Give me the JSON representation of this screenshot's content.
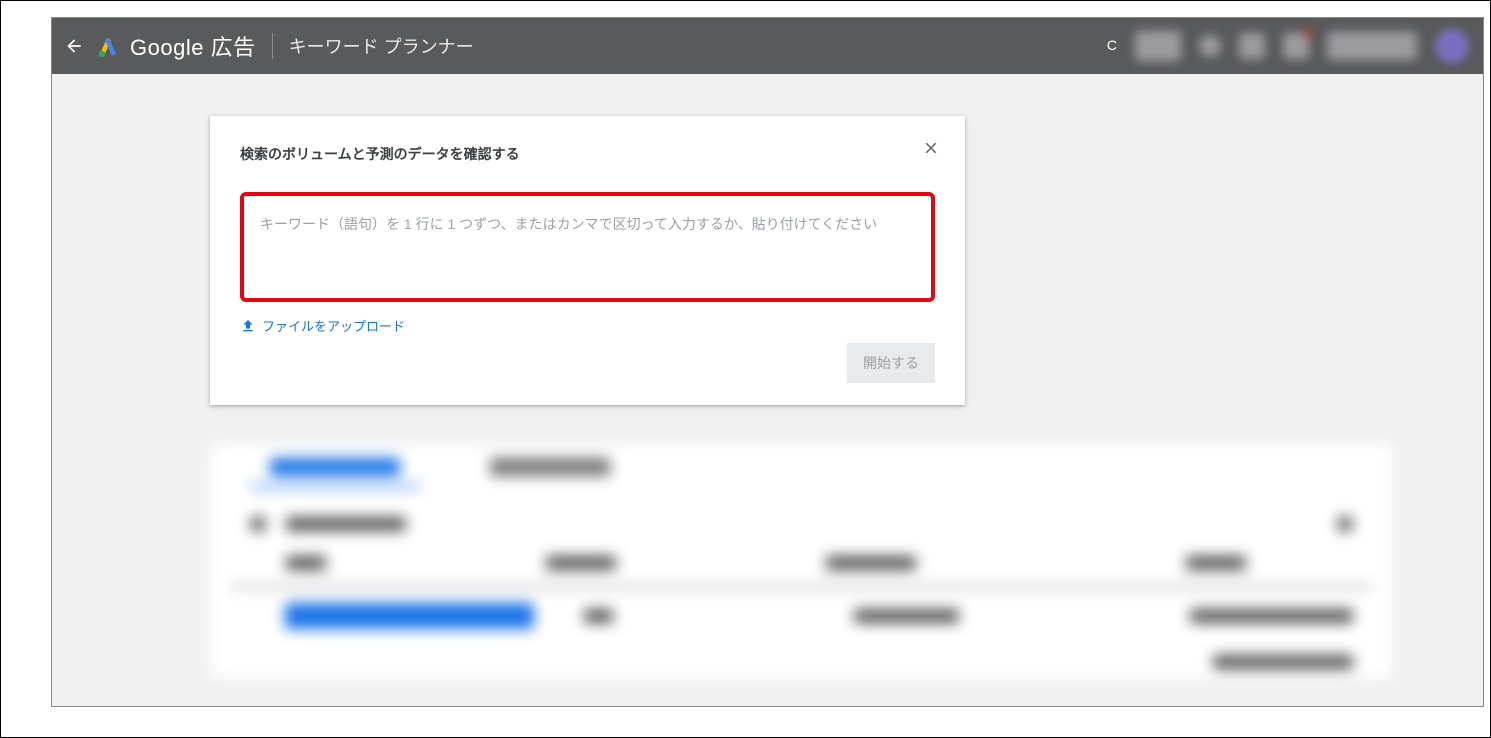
{
  "header": {
    "brand_prefix": "Google",
    "brand_suffix": " 広告",
    "tool_name": "キーワード プランナー",
    "right_char": "C"
  },
  "dialog": {
    "title": "検索のボリュームと予測のデータを確認する",
    "input_placeholder": "キーワード（語句）を 1 行に 1 つずつ、またはカンマで区切って入力するか、貼り付けてください",
    "upload_label": "ファイルをアップロード",
    "start_label": "開始する"
  }
}
